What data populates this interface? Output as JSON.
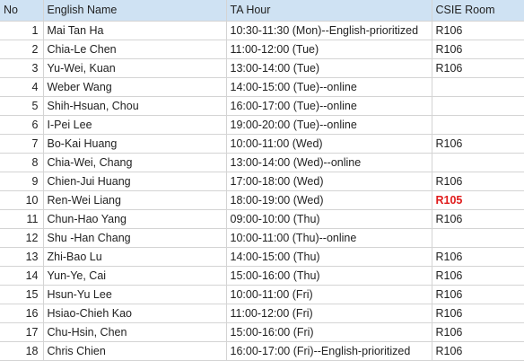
{
  "headers": {
    "no": "No",
    "name": "English Name",
    "hour": "TA Hour",
    "room": "CSIE Room"
  },
  "colors": {
    "header_bg": "#cfe2f3",
    "grid": "#d4d4d4",
    "alert_text": "#e01b1b"
  },
  "rows": [
    {
      "no": "1",
      "name": "Mai Tan Ha",
      "hour": "10:30-11:30 (Mon)--English-prioritized",
      "room": "R106"
    },
    {
      "no": "2",
      "name": "Chia-Le Chen",
      "hour": "11:00-12:00 (Tue)",
      "room": "R106"
    },
    {
      "no": "3",
      "name": "Yu-Wei, Kuan",
      "hour": "13:00-14:00 (Tue)",
      "room": "R106"
    },
    {
      "no": "4",
      "name": "Weber Wang",
      "hour": "14:00-15:00 (Tue)--online",
      "room": ""
    },
    {
      "no": "5",
      "name": "Shih-Hsuan, Chou",
      "hour": "16:00-17:00 (Tue)--online",
      "room": ""
    },
    {
      "no": "6",
      "name": "I-Pei Lee",
      "hour": "19:00-20:00 (Tue)--online",
      "room": ""
    },
    {
      "no": "7",
      "name": "Bo-Kai Huang",
      "hour": "10:00-11:00 (Wed)",
      "room": "R106"
    },
    {
      "no": "8",
      "name": "Chia-Wei, Chang",
      "hour": "13:00-14:00 (Wed)--online",
      "room": ""
    },
    {
      "no": "9",
      "name": "Chien-Jui Huang",
      "hour": "17:00-18:00 (Wed)",
      "room": "R106"
    },
    {
      "no": "10",
      "name": "Ren-Wei Liang",
      "hour": "18:00-19:00 (Wed)",
      "room": "R105",
      "room_alert": true
    },
    {
      "no": "11",
      "name": "Chun-Hao Yang",
      "hour": "09:00-10:00 (Thu)",
      "room": "R106"
    },
    {
      "no": "12",
      "name": "Shu -Han Chang",
      "hour": "10:00-11:00 (Thu)--online",
      "room": ""
    },
    {
      "no": "13",
      "name": "Zhi-Bao Lu",
      "hour": "14:00-15:00 (Thu)",
      "room": "R106"
    },
    {
      "no": "14",
      "name": "Yun-Ye, Cai",
      "hour": "15:00-16:00 (Thu)",
      "room": "R106"
    },
    {
      "no": "15",
      "name": "Hsun-Yu Lee",
      "hour": "10:00-11:00 (Fri)",
      "room": "R106"
    },
    {
      "no": "16",
      "name": "Hsiao-Chieh Kao",
      "hour": "11:00-12:00 (Fri)",
      "room": "R106"
    },
    {
      "no": "17",
      "name": "Chu-Hsin, Chen",
      "hour": "15:00-16:00 (Fri)",
      "room": "R106"
    },
    {
      "no": "18",
      "name": "Chris Chien",
      "hour": "16:00-17:00 (Fri)--English-prioritized",
      "room": "R106"
    }
  ]
}
